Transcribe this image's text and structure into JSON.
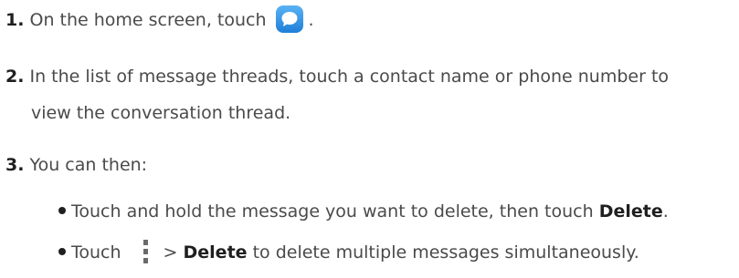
{
  "steps": [
    {
      "number": "1.",
      "text_before": "On the home screen, touch",
      "icon": "messaging-app-icon",
      "text_after": "."
    },
    {
      "number": "2.",
      "line1": "In the list of message threads, touch a contact name or phone number to",
      "line2": "view the conversation thread."
    },
    {
      "number": "3.",
      "text": "You can then:"
    }
  ],
  "bullets": [
    {
      "text_before": "Touch and hold the message you want to delete, then touch",
      "bold": "Delete",
      "text_after": "."
    },
    {
      "text_before": "Touch",
      "icon": "more-options-icon",
      "separator": ">",
      "bold": "Delete",
      "text_after": "to delete multiple messages simultaneously."
    }
  ]
}
